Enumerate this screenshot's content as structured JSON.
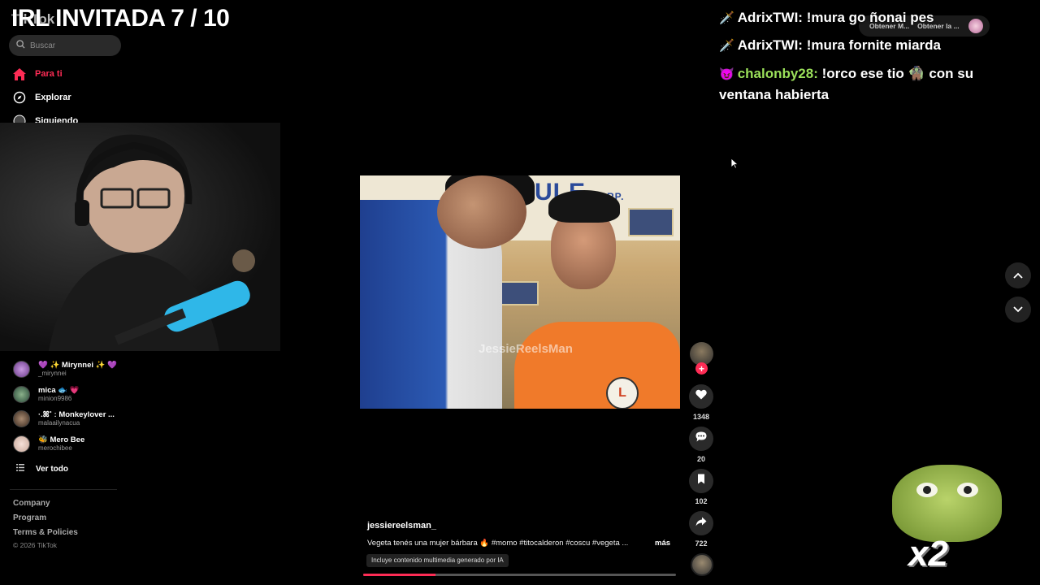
{
  "overlay": {
    "title": "IRL INVITADA 7 / 10",
    "logo_text": "TikTok"
  },
  "search": {
    "placeholder": "Buscar"
  },
  "nav": [
    {
      "label": "Para ti",
      "icon": "home-icon",
      "active": true
    },
    {
      "label": "Explorar",
      "icon": "compass-icon"
    },
    {
      "label": "Siguiendo",
      "icon": "following-icon"
    }
  ],
  "following": [
    {
      "name": "💜 ✨ Mirynnei ✨ 💜",
      "handle": "_mirynnei"
    },
    {
      "name": "mica 🐟 💗",
      "handle": "minion9986"
    },
    {
      "name": "·.ꕤ˚ ː Monkeylover ...",
      "handle": "malaailynacua"
    },
    {
      "name": "🐝 Mero Bee",
      "handle": "merochibee"
    }
  ],
  "see_all": "Ver todo",
  "footer": {
    "company": "Company",
    "program": "Program",
    "terms": "Terms & Policies",
    "copyright": "© 2026 TikTok"
  },
  "video": {
    "sign": "ULE",
    "sign_small": "CORP.",
    "watermark": "JessieReelsMan",
    "author": "jessiereelsman_",
    "caption": "Vegeta tenés una mujer bárbara 🔥 #momo #titocalderon #coscu #vegeta ...",
    "more": "más",
    "ai_label": "Incluye contenido multimedia generado por IA",
    "progress": 0.23
  },
  "actions": {
    "likes": "1348",
    "comments": "20",
    "saves": "102",
    "shares": "722"
  },
  "top_actions": {
    "btn1": "Obtener M...",
    "btn2": "Obtener la ..."
  },
  "chat": [
    {
      "user": "AdrixTWI:",
      "message": "!mura go ñonai pes",
      "badge": "🗡️",
      "style": "user-a"
    },
    {
      "user": "AdrixTWI:",
      "message": "!mura fornite miarda",
      "badge": "🗡️",
      "style": "user-a"
    },
    {
      "user": "chalonby28:",
      "message": "!orco ese tio 🧌 con su ventana habierta",
      "badge": "😈",
      "style": "user-b"
    }
  ],
  "sticker": {
    "multiplier": "x2"
  },
  "colors": {
    "accent": "#fe2c55",
    "background": "#000000",
    "chat_green": "#9be05a"
  }
}
